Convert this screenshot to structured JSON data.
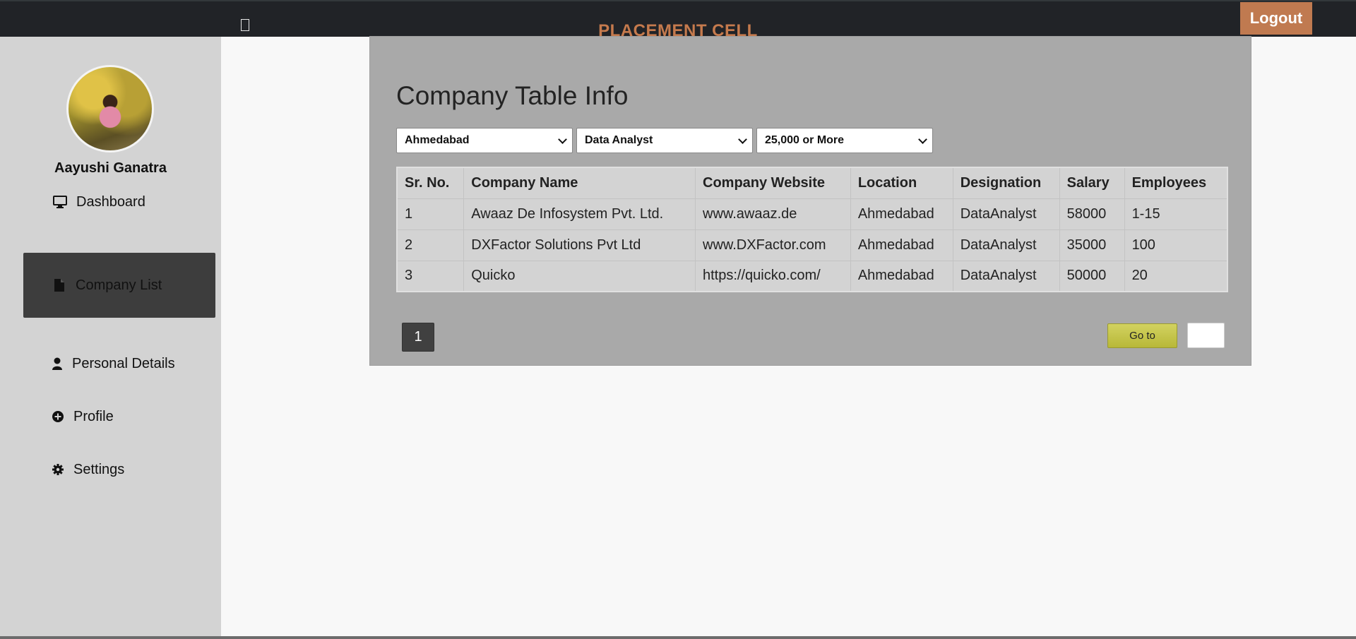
{
  "header": {
    "brand": "PLACEMENT CELL",
    "logout_label": "Logout"
  },
  "sidebar": {
    "user_name": "Aayushi Ganatra",
    "items": [
      {
        "label": "Dashboard",
        "icon": "desktop-icon"
      },
      {
        "label": "Company List",
        "icon": "file-icon",
        "active": true
      },
      {
        "label": "Personal Details",
        "icon": "user-icon"
      },
      {
        "label": "Profile",
        "icon": "plus-circle-icon"
      },
      {
        "label": "Settings",
        "icon": "gear-icon"
      }
    ]
  },
  "main": {
    "title": "Company Table Info",
    "filters": {
      "location": "Ahmedabad",
      "designation": "Data Analyst",
      "salary": "25,000 or More"
    },
    "table": {
      "headers": [
        "Sr. No.",
        "Company Name",
        "Company Website",
        "Location",
        "Designation",
        "Salary",
        "Employees"
      ],
      "rows": [
        [
          "1",
          "Awaaz De Infosystem Pvt. Ltd.",
          "www.awaaz.de",
          "Ahmedabad",
          "DataAnalyst",
          "58000",
          "1-15"
        ],
        [
          "2",
          "DXFactor Solutions Pvt Ltd",
          "www.DXFactor.com",
          "Ahmedabad",
          "DataAnalyst",
          "35000",
          "100"
        ],
        [
          "3",
          "Quicko",
          "https://quicko.com/",
          "Ahmedabad",
          "DataAnalyst",
          "50000",
          "20"
        ]
      ]
    },
    "pagination": {
      "current_page": "1",
      "goto_label": "Go to",
      "goto_value": ""
    }
  },
  "colors": {
    "topbar": "#212327",
    "brand": "#c57a4d",
    "logout": "#c07a50",
    "sidebar": "#d3d3d3",
    "active_item": "#3d3d3d",
    "card": "#a9a9a9"
  }
}
